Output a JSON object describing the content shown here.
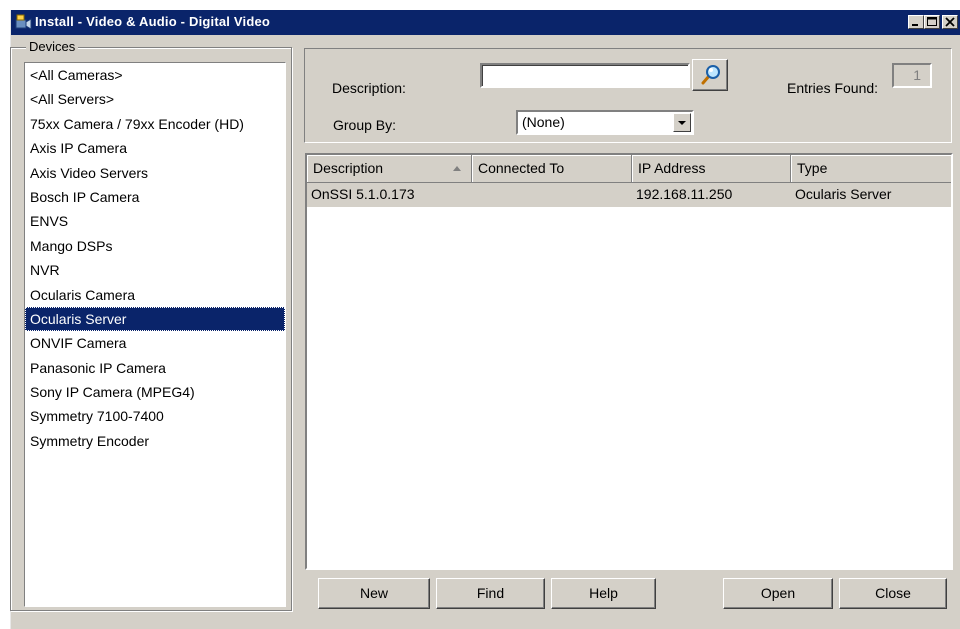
{
  "window": {
    "title": "Install - Video & Audio - Digital Video",
    "controls": [
      "minimize",
      "maximize",
      "close"
    ]
  },
  "devices": {
    "label": "Devices",
    "items": [
      "<All Cameras>",
      "<All Servers>",
      "75xx Camera / 79xx Encoder (HD)",
      "Axis IP Camera",
      "Axis Video Servers",
      "Bosch IP Camera",
      "ENVS",
      "Mango DSPs",
      "NVR",
      "Ocularis Camera",
      "Ocularis Server",
      "ONVIF Camera",
      "Panasonic IP Camera",
      "Sony IP Camera (MPEG4)",
      "Symmetry 7100-7400",
      "Symmetry Encoder"
    ],
    "selected": "Ocularis Server"
  },
  "filter": {
    "description_label": "Description:",
    "description_value": "",
    "search_icon": "search-icon",
    "entries_label": "Entries Found:",
    "entries_value": "1",
    "group_by_label": "Group By:",
    "group_by_value": "(None)"
  },
  "grid": {
    "columns": [
      "Description",
      "Connected To",
      "IP Address",
      "Type"
    ],
    "sort_column": "Description",
    "rows": [
      {
        "description": "OnSSI 5.1.0.173",
        "connected_to": "",
        "ip_address": "192.168.11.250",
        "type": "Ocularis Server"
      }
    ]
  },
  "buttons": {
    "new": "New",
    "find": "Find",
    "help": "Help",
    "open": "Open",
    "close": "Close"
  }
}
